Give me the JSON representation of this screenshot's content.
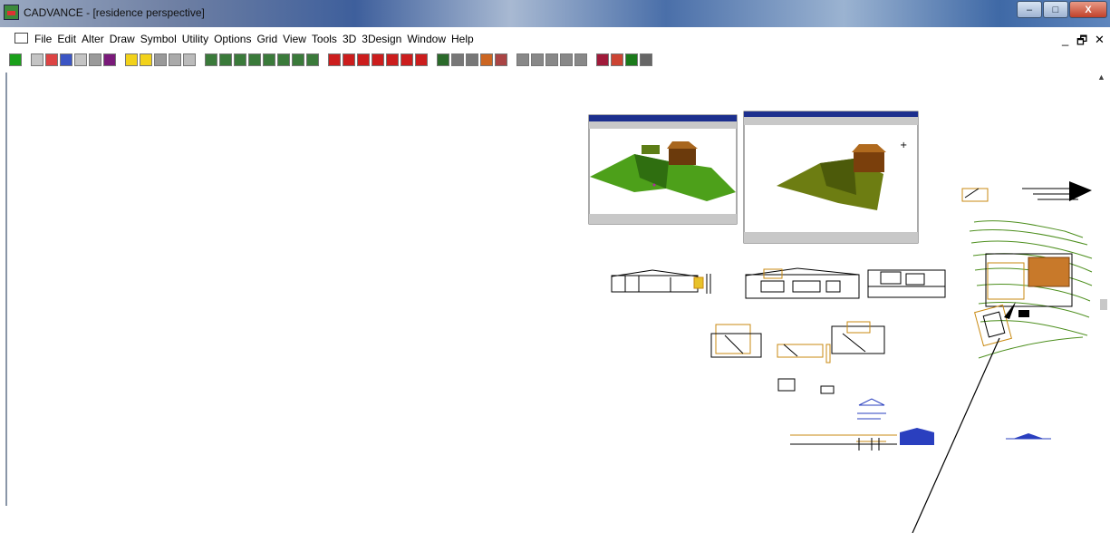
{
  "window": {
    "title": "CADVANCE - [residence perspective]",
    "controls": {
      "minimize": "–",
      "maximize": "□",
      "close": "X"
    }
  },
  "menubar": {
    "items": [
      "File",
      "Edit",
      "Alter",
      "Draw",
      "Symbol",
      "Utility",
      "Options",
      "Grid",
      "View",
      "Tools",
      "3D",
      "3Design",
      "Window",
      "Help"
    ],
    "doc_controls": {
      "minimize": "_",
      "restore": "🗗",
      "close": "✕"
    }
  },
  "toolbar": {
    "colors": {
      "green": "#1aa01a",
      "red": "#cc1d1d",
      "yellow": "#f2d21a",
      "blue": "#1a3fbf",
      "purple": "#7a1a7a"
    },
    "buttons": [
      "diamond-icon",
      "new-icon",
      "open-icon",
      "save-icon",
      "print-icon",
      "plot-icon",
      "render-icon",
      "draw-line-icon",
      "draw-line-yellow-icon",
      "move-icon",
      "rotate-icon",
      "copy-icon",
      "grid-1-icon",
      "grid-2-icon",
      "grid-3-icon",
      "grid-4-icon",
      "grid-5-icon",
      "grid-6-icon",
      "grid-7-icon",
      "grid-8-icon",
      "red-tool-1-icon",
      "red-tool-2-icon",
      "red-tool-3-icon",
      "red-tool-4-icon",
      "red-tool-5-icon",
      "red-tool-6-icon",
      "text-tool-icon",
      "layer-1-icon",
      "layer-2-icon",
      "layer-3-icon",
      "check-icon",
      "layout-icon",
      "pan-icon",
      "zoom-icon",
      "zoom-window-icon",
      "zoom-extents-icon",
      "pencil-icon",
      "cv-1-icon",
      "cv-2-icon",
      "cv-3-icon",
      "dropdown-icon"
    ]
  },
  "canvas": {
    "drawing_colors": {
      "terrain": "#4d8f1e",
      "roof": "#8a4a12",
      "lines": "#000000",
      "orange": "#c98a12",
      "blue": "#2a3fbf"
    }
  }
}
